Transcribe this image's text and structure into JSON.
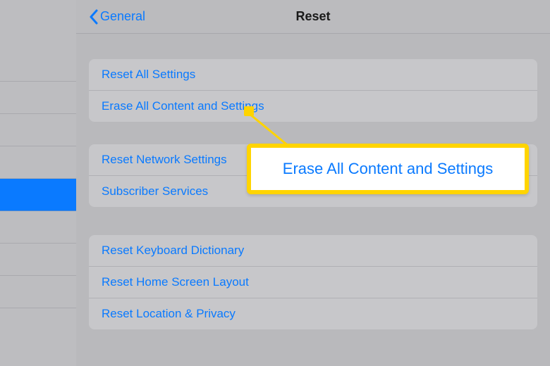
{
  "nav": {
    "back_label": "General",
    "title": "Reset"
  },
  "groups": [
    {
      "rows": [
        {
          "label": "Reset All Settings"
        },
        {
          "label": "Erase All Content and Settings"
        }
      ]
    },
    {
      "rows": [
        {
          "label": "Reset Network Settings"
        },
        {
          "label": "Subscriber Services"
        }
      ]
    },
    {
      "rows": [
        {
          "label": "Reset Keyboard Dictionary"
        },
        {
          "label": "Reset Home Screen Layout"
        },
        {
          "label": "Reset Location & Privacy"
        }
      ]
    }
  ],
  "callout": {
    "text": "Erase All Content and Settings"
  }
}
